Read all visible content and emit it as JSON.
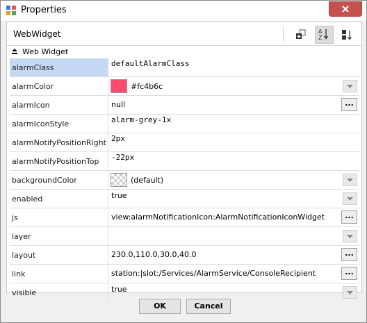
{
  "window": {
    "title": "Properties"
  },
  "header": {
    "title": "WebWidget"
  },
  "section": {
    "label": "Web Widget"
  },
  "toolbar": {
    "icons": [
      "add-slot-icon",
      "sort-az-icon",
      "sort-order-icon"
    ]
  },
  "colors": {
    "alarmColor": "#fc4b6c",
    "selected_row": "#c6d9f4",
    "close_button": "#c75050"
  },
  "properties": [
    {
      "name": "alarmClass",
      "value": "defaultAlarmClass"
    },
    {
      "name": "alarmColor",
      "value": "#fc4b6c"
    },
    {
      "name": "alarmIcon",
      "value": "null"
    },
    {
      "name": "alarmIconStyle",
      "value": "alarm-grey-1x"
    },
    {
      "name": "alarmNotifyPositionRight",
      "value": "2px"
    },
    {
      "name": "alarmNotifyPositionTop",
      "value": "-22px"
    },
    {
      "name": "backgroundColor",
      "value": "(default)"
    },
    {
      "name": "enabled",
      "value": "true"
    },
    {
      "name": "js",
      "value": "view:alarmNotificationIcon:AlarmNotificationIconWidget"
    },
    {
      "name": "layer",
      "value": ""
    },
    {
      "name": "layout",
      "value": "230.0,110.0,30.0,40.0"
    },
    {
      "name": "link",
      "value": "station:|slot:/Services/AlarmService/ConsoleRecipient"
    },
    {
      "name": "visible",
      "value": "true"
    }
  ],
  "ellipsis_label": "...",
  "buttons": {
    "ok": "OK",
    "cancel": "Cancel"
  }
}
